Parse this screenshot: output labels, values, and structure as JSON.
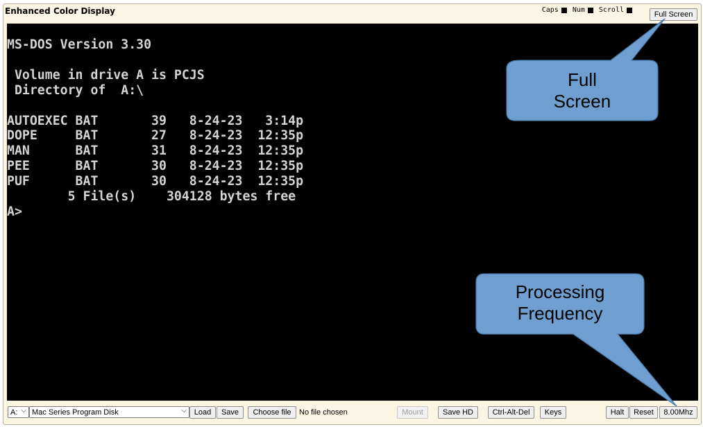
{
  "window": {
    "title": "Enhanced Color Display"
  },
  "indicators": [
    {
      "label": "Caps"
    },
    {
      "label": "Num"
    },
    {
      "label": "Scroll"
    }
  ],
  "toolbar_top": {
    "full_screen_label": "Full Screen"
  },
  "screen": {
    "lines": [
      "MS-DOS Version 3.30",
      "",
      " Volume in drive A is PCJS",
      " Directory of  A:\\",
      "",
      "AUTOEXEC BAT       39   8-24-23   3:14p",
      "DOPE     BAT       27   8-24-23  12:35p",
      "MAN      BAT       31   8-24-23  12:35p",
      "PEE      BAT       30   8-24-23  12:35p",
      "PUF      BAT       30   8-24-23  12:35p",
      "        5 File(s)    304128 bytes free",
      "A>"
    ]
  },
  "bottom": {
    "drive_select": "A:",
    "disk_select": "Mac Series Program Disk",
    "load_label": "Load",
    "save_label": "Save",
    "choose_file_label": "Choose file",
    "no_file_text": "No file chosen",
    "mount_label": "Mount",
    "save_hd_label": "Save HD",
    "ctrl_alt_del_label": "Ctrl-Alt-Del",
    "keys_label": "Keys",
    "halt_label": "Halt",
    "reset_label": "Reset",
    "speed_label": "8.00Mhz"
  },
  "callouts": {
    "full_screen": {
      "line1": "Full",
      "line2": "Screen"
    },
    "frequency": {
      "line1": "Processing",
      "line2": "Frequency"
    },
    "fill_color": "#6f9fd0",
    "stroke_color": "#4a78a8"
  }
}
